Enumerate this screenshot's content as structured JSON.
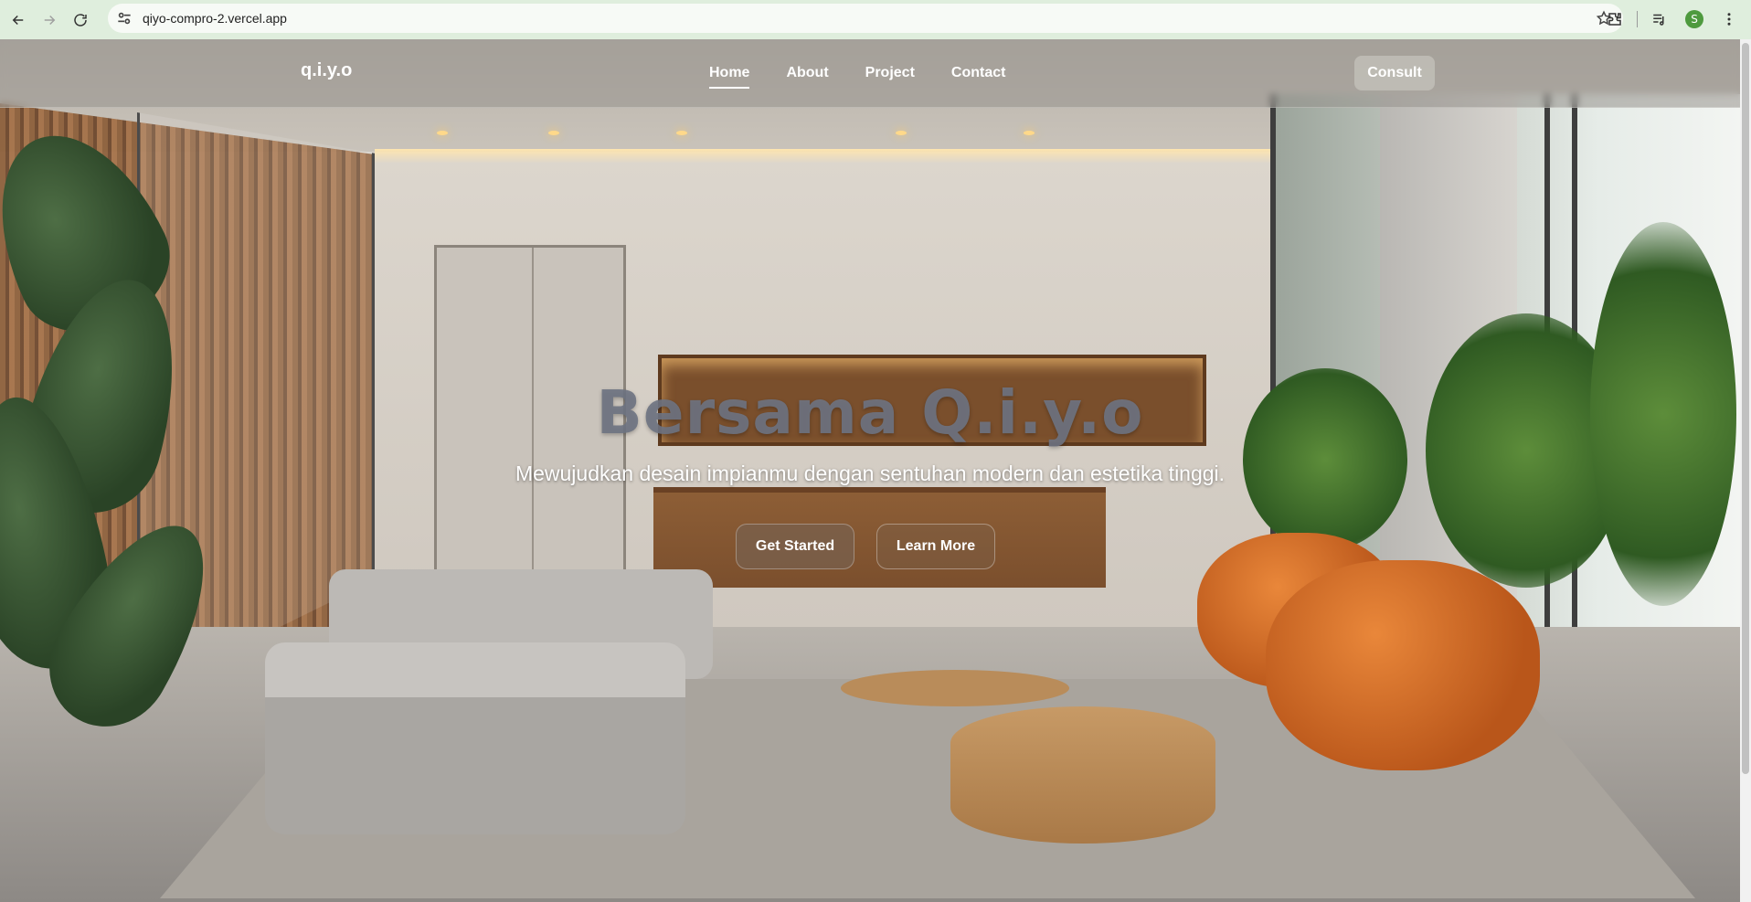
{
  "browser": {
    "url": "qiyo-compro-2.vercel.app",
    "profile_initial": "S",
    "icons": [
      "back-icon",
      "forward-icon",
      "reload-icon",
      "site-settings-icon",
      "bookmark-star-icon",
      "extensions-icon",
      "media-control-icon",
      "more-menu-icon"
    ]
  },
  "header": {
    "brand": "q.i.y.o",
    "nav": [
      {
        "label": "Home",
        "active": true
      },
      {
        "label": "About",
        "active": false
      },
      {
        "label": "Project",
        "active": false
      },
      {
        "label": "Contact",
        "active": false
      }
    ],
    "cta": "Consult"
  },
  "hero": {
    "title": "Bersama Q.i.y.o",
    "subtitle": "Mewujudkan desain impianmu dengan sentuhan modern dan estetika tinggi.",
    "primary_button": "Get Started",
    "secondary_button": "Learn More"
  },
  "colors": {
    "chrome_bg": "#dfeedd",
    "avatar_bg": "#4e9a3e",
    "title_color": "#6e7382"
  }
}
